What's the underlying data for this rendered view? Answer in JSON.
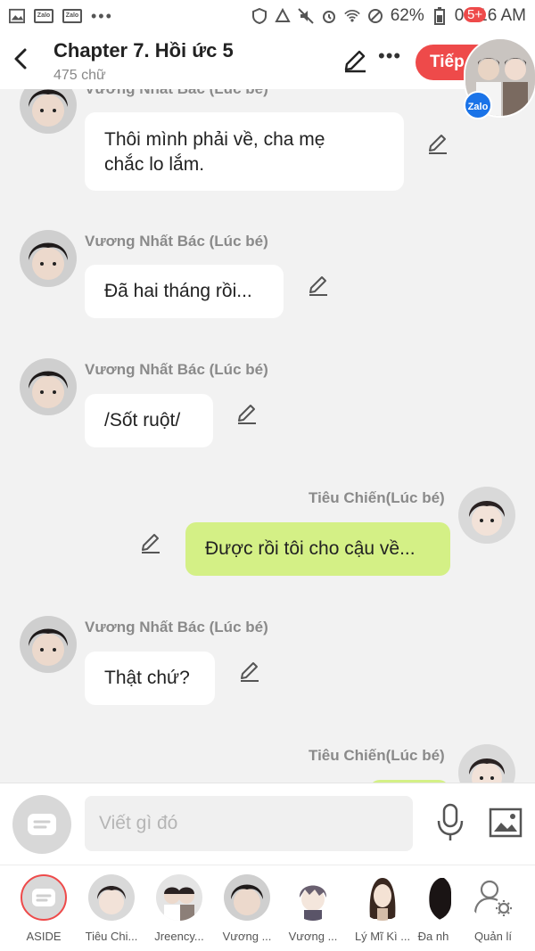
{
  "status": {
    "battery": "62%",
    "time": "08:16 AM",
    "app_badge_1": "Zalo",
    "app_badge_2": "Zalo",
    "more_dots": "•••"
  },
  "header": {
    "title": "Chapter 7. Hồi ức 5",
    "subtitle": "475 chữ",
    "more_label": "•••",
    "next_label": "Tiếp",
    "badge": "5+",
    "chat_head_label": "Zalo"
  },
  "messages": [
    {
      "sender": "Vương Nhất Bác (Lúc bé)",
      "text": "Thôi mình phải về, cha mẹ\nchắc lo lắm.",
      "side": "left"
    },
    {
      "sender": "Vương Nhất Bác (Lúc bé)",
      "text": "Đã hai tháng rồi...",
      "side": "left"
    },
    {
      "sender": "Vương Nhất Bác (Lúc bé)",
      "text": "/Sốt ruột/",
      "side": "left"
    },
    {
      "sender": "Tiêu Chiến(Lúc bé)",
      "text": "Được rồi tôi cho cậu về...",
      "side": "right"
    },
    {
      "sender": "Vương Nhất Bác (Lúc bé)",
      "text": "Thật chứ?",
      "side": "left"
    },
    {
      "sender": "Tiêu Chiến(Lúc bé)",
      "text": "",
      "side": "right"
    }
  ],
  "composer": {
    "placeholder": "Viết gì đó"
  },
  "characters": [
    {
      "label": "ASIDE"
    },
    {
      "label": "Tiêu Chi..."
    },
    {
      "label": "Jreency..."
    },
    {
      "label": "Vương ..."
    },
    {
      "label": "Vương ..."
    },
    {
      "label": "Lý Mĩ Kì ..."
    },
    {
      "label": "Đa nh"
    },
    {
      "label": "Quản lí"
    }
  ],
  "colors": {
    "accent_red": "#ee4a4a",
    "my_bubble": "#d4f086",
    "their_bubble": "#ffffff",
    "background": "#f2f2f2"
  }
}
